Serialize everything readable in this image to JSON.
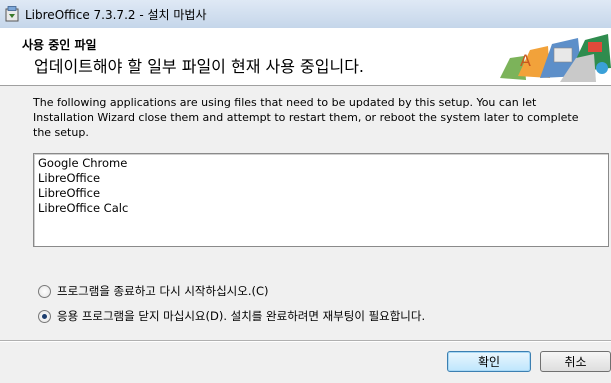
{
  "window": {
    "title": "LibreOffice 7.3.7.2 - 설치 마법사"
  },
  "header": {
    "title": "사용 중인 파일",
    "subtitle": "업데이트해야 할 일부 파일이 현재 사용 중입니다."
  },
  "description": "The following applications are using files that need to be updated by this setup. You can let Installation Wizard close them and attempt to restart them, or reboot the system later to complete the setup.",
  "applications": [
    "Google Chrome",
    "LibreOffice",
    "LibreOffice",
    "LibreOffice Calc"
  ],
  "options": [
    {
      "label": "프로그램을 종료하고 다시 시작하십시오.(C)",
      "selected": false
    },
    {
      "label": "응용 프로그램을 닫지 마십시요(D). 설치를 완료하려면 재부팅이 필요합니다.",
      "selected": true
    }
  ],
  "buttons": {
    "ok": "확인",
    "cancel": "취소"
  }
}
